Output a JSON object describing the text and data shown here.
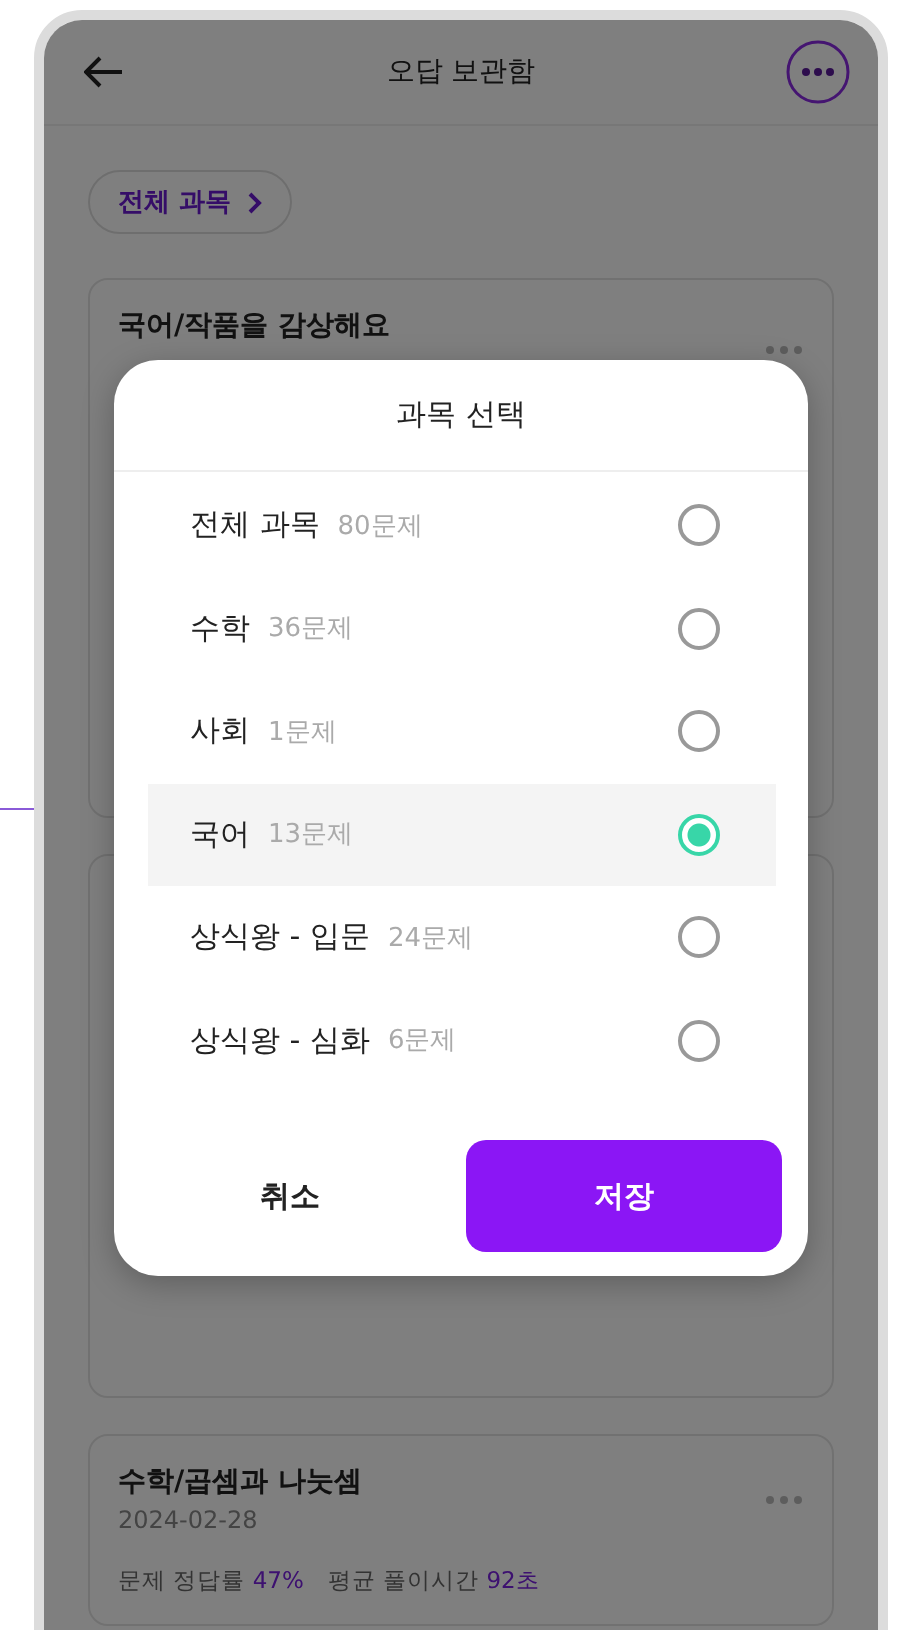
{
  "header": {
    "title": "오답 보관함"
  },
  "filter_chip": {
    "label": "전체 과목"
  },
  "cards": [
    {
      "kind": "entry",
      "title": "국어/작품을 감상해요"
    },
    {
      "kind": "blank"
    },
    {
      "kind": "entry",
      "title": "수학/곱셈과 나눗셈",
      "date": "2024-02-28",
      "stats": [
        {
          "label": "문제 정답률",
          "value": "47%"
        },
        {
          "label": "평균 풀이시간",
          "value": "92초"
        }
      ]
    }
  ],
  "dialog": {
    "title": "과목 선택",
    "options": [
      {
        "label": "전체 과목",
        "count": "80문제",
        "selected": false
      },
      {
        "label": "수학",
        "count": "36문제",
        "selected": false
      },
      {
        "label": "사회",
        "count": "1문제",
        "selected": false
      },
      {
        "label": "국어",
        "count": "13문제",
        "selected": true
      },
      {
        "label": "상식왕 - 입문",
        "count": "24문제",
        "selected": false
      },
      {
        "label": "상식왕 - 심화",
        "count": "6문제",
        "selected": false
      }
    ],
    "cancel": "취소",
    "save": "저장"
  }
}
